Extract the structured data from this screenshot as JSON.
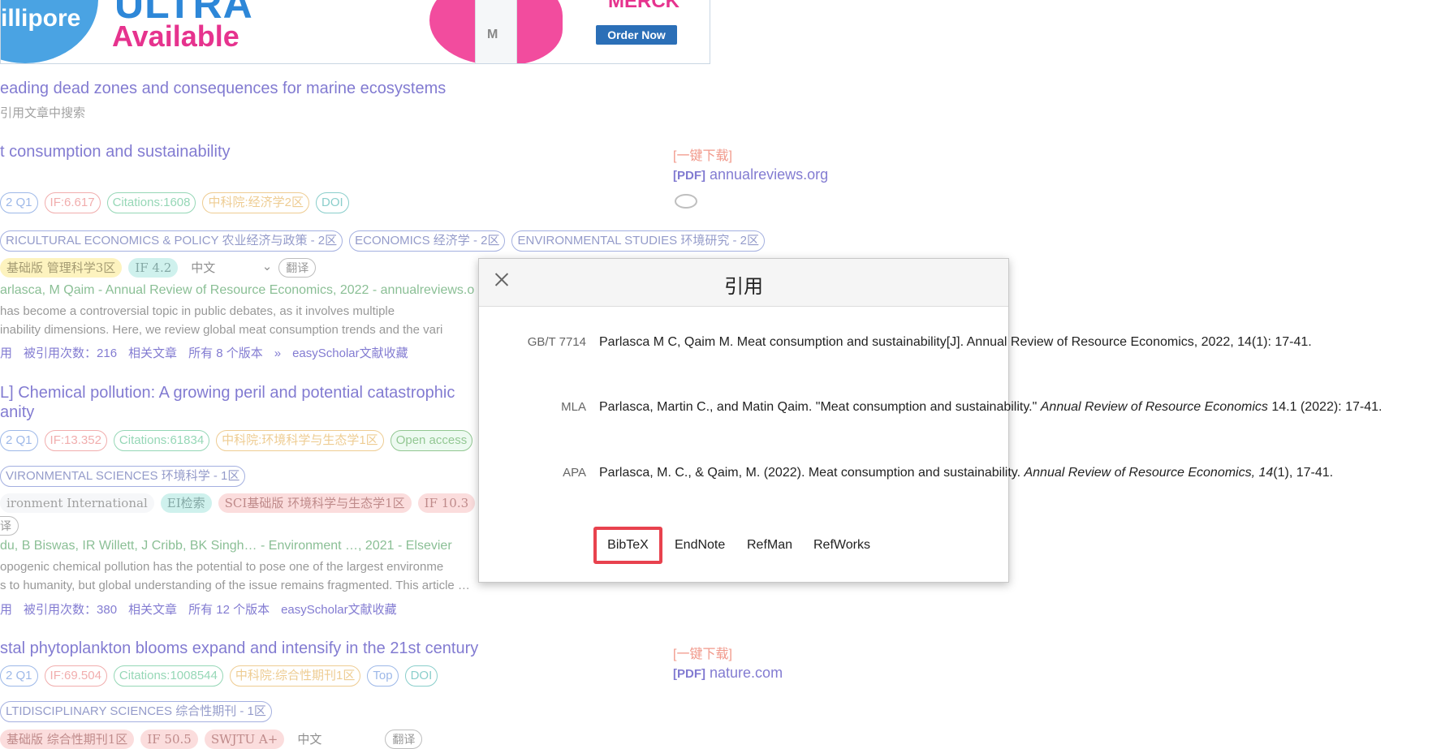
{
  "banner": {
    "brand": "illipore",
    "product": "ULTRA",
    "availability": "Available",
    "vendor": "MERCK",
    "vial_mark": "M",
    "cta": "Order Now"
  },
  "results": [
    {
      "title": "eading dead zones and consequences for marine ecosystems",
      "note": "引用文章中搜索"
    },
    {
      "title": "t consumption and sustainability",
      "tags": [
        "2 Q1",
        "IF:6.617",
        "Citations:1608",
        "中科院:经济学2区",
        "DOI"
      ],
      "categories": [
        "RICULTURAL ECONOMICS & POLICY 农业经济与政策 - 2区",
        "ECONOMICS 经济学 - 2区",
        "ENVIRONMENTAL STUDIES 环境研究 - 2区"
      ],
      "chips": [
        "基础版 管理科学3区",
        "IF 4.2"
      ],
      "language": "中文",
      "translate": "翻译",
      "authors": "arlasca, M Qaim - Annual Review of Resource Economics, 2022 - annualreviews.o",
      "snippet": [
        "has become a controversial topic in public debates, as it involves multiple",
        "inability dimensions. Here, we review global meat consumption trends and the vari"
      ],
      "links": [
        "用",
        "被引用次数：216",
        "相关文章",
        "所有 8 个版本",
        "»",
        "easyScholar文献收藏"
      ],
      "side": {
        "download": "[一键下载]",
        "pdf_tag": "[PDF]",
        "source": "annualreviews.org"
      }
    },
    {
      "title": "L] Chemical pollution: A growing peril and potential catastrophic",
      "title2": "anity",
      "tags": [
        "2 Q1",
        "IF:13.352",
        "Citations:61834",
        "中科院:环境科学与生态学1区",
        "Open access"
      ],
      "categories": [
        "VIRONMENTAL SCIENCES 环境科学 - 1区"
      ],
      "chips": [
        "ironment International",
        "EI检索",
        "SCI基础版 环境科学与生态学1区",
        "IF 10.3"
      ],
      "chip_extra": "译",
      "authors": "du, B Biswas, IR Willett, J Cribb, BK Singh… - Environment …, 2021 - Elsevier",
      "snippet": [
        "opogenic chemical pollution has the potential to pose one of the largest environme",
        "s to humanity, but global understanding of the issue remains fragmented. This article …"
      ],
      "links": [
        "用",
        "被引用次数：380",
        "相关文章",
        "所有 12 个版本",
        "easyScholar文献收藏"
      ]
    },
    {
      "title": "stal phytoplankton blooms expand and intensify in the 21st century",
      "tags": [
        "2 Q1",
        "IF:69.504",
        "Citations:1008544",
        "中科院:综合性期刊1区",
        "Top",
        "DOI"
      ],
      "categories": [
        "LTIDISCIPLINARY SCIENCES 综合性期刊 - 1区"
      ],
      "chips": [
        "基础版 综合性期刊1区",
        "IF 50.5",
        "SWJTU A+"
      ],
      "language": "中文",
      "translate": "翻译",
      "side": {
        "download": "[一键下载]",
        "pdf_tag": "[PDF]",
        "source": "nature.com"
      }
    }
  ],
  "modal": {
    "title": "引用",
    "citations": [
      {
        "label": "GB/T 7714",
        "text": "Parlasca M C, Qaim M. Meat consumption and sustainability[J]. Annual Review of Resource Economics, 2022, 14(1): 17-41."
      },
      {
        "label": "MLA",
        "text_pre": "Parlasca, Martin C., and Matin Qaim. \"Meat consumption and sustainability.\" ",
        "text_italic": "Annual Review of Resource Economics",
        "text_post": " 14.1 (2022): 17-41."
      },
      {
        "label": "APA",
        "text_pre": "Parlasca, M. C., & Qaim, M. (2022). Meat consumption and sustainability. ",
        "text_italic": "Annual Review of Resource Economics, 14",
        "text_post": "(1), 17-41."
      }
    ],
    "formats": [
      "BibTeX",
      "EndNote",
      "RefMan",
      "RefWorks"
    ]
  }
}
